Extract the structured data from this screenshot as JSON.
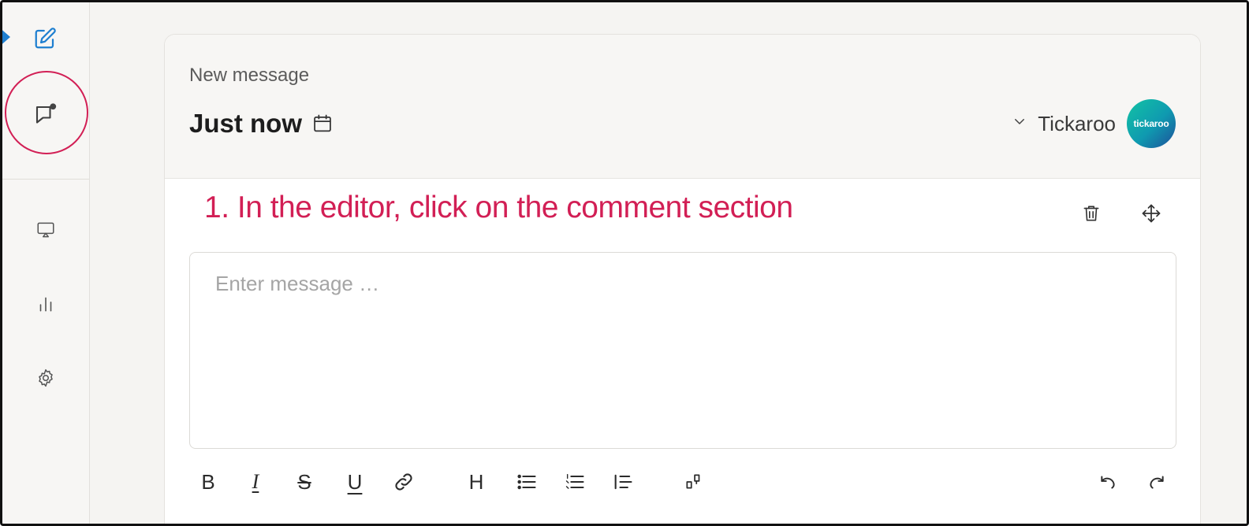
{
  "sidebar": {
    "icons": [
      "edit-icon",
      "comment-notification-icon",
      "cast-icon",
      "bar-chart-icon",
      "settings-gear-icon"
    ]
  },
  "card": {
    "header_small": "New message",
    "time_label": "Just now",
    "author_name": "Tickaroo",
    "avatar_text": "tickaroo"
  },
  "instruction": "1. In the editor, click on the comment section",
  "editor": {
    "placeholder": "Enter message …"
  },
  "toolbar": {
    "bold": "B",
    "italic": "I",
    "strike": "S",
    "underline": "U",
    "heading": "H"
  },
  "colors": {
    "accent": "#d21f55",
    "active_marker": "#1e7fd0",
    "edit_icon": "#1e7fd0"
  }
}
